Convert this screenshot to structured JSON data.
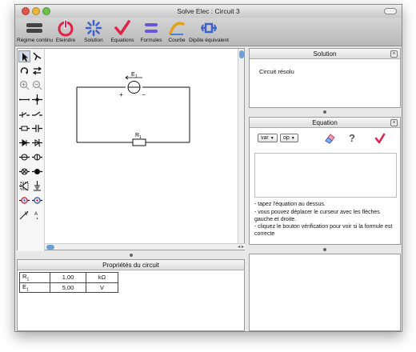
{
  "window": {
    "title": "Solve Elec : Circuit 3"
  },
  "toolbar": {
    "items": [
      {
        "label": "Régime continu",
        "icon": "battery-icon"
      },
      {
        "label": "Eteindre",
        "icon": "power-icon"
      },
      {
        "label": "Solution",
        "icon": "sparkle-icon"
      },
      {
        "label": "Equations",
        "icon": "checkmark-icon"
      },
      {
        "label": "Formules",
        "icon": "formula-icon"
      },
      {
        "label": "Courbe",
        "icon": "curve-icon"
      },
      {
        "label": "Dipôle équivalent",
        "icon": "dipole-icon"
      }
    ]
  },
  "circuit": {
    "labels": {
      "e1": "E",
      "e1_sub": "1",
      "r1": "R",
      "r1_sub": "1",
      "plus": "+",
      "minus": "−"
    }
  },
  "properties": {
    "title": "Propriétés du circuit",
    "rows": [
      {
        "name": "R",
        "sub": "1",
        "value": "1,00",
        "unit": "kΩ"
      },
      {
        "name": "E",
        "sub": "1",
        "value": "5,00",
        "unit": "V"
      }
    ]
  },
  "solution_panel": {
    "title": "Solution",
    "text": "Circuit résolu"
  },
  "equation_panel": {
    "title": "Equation",
    "var_label": "var",
    "op_label": "op",
    "help_char": "?",
    "help": [
      "- tapez l'équation au dessus.",
      "- vous pouvez déplacer le curseur avec les flèches gauche et droite.",
      "- cliquez le bouton vérification pour voir si la formule est correcte"
    ]
  },
  "colors": {
    "accent_red": "#e0224a",
    "accent_blue": "#3b63c9",
    "scroll_blue": "#6b9fd8"
  }
}
